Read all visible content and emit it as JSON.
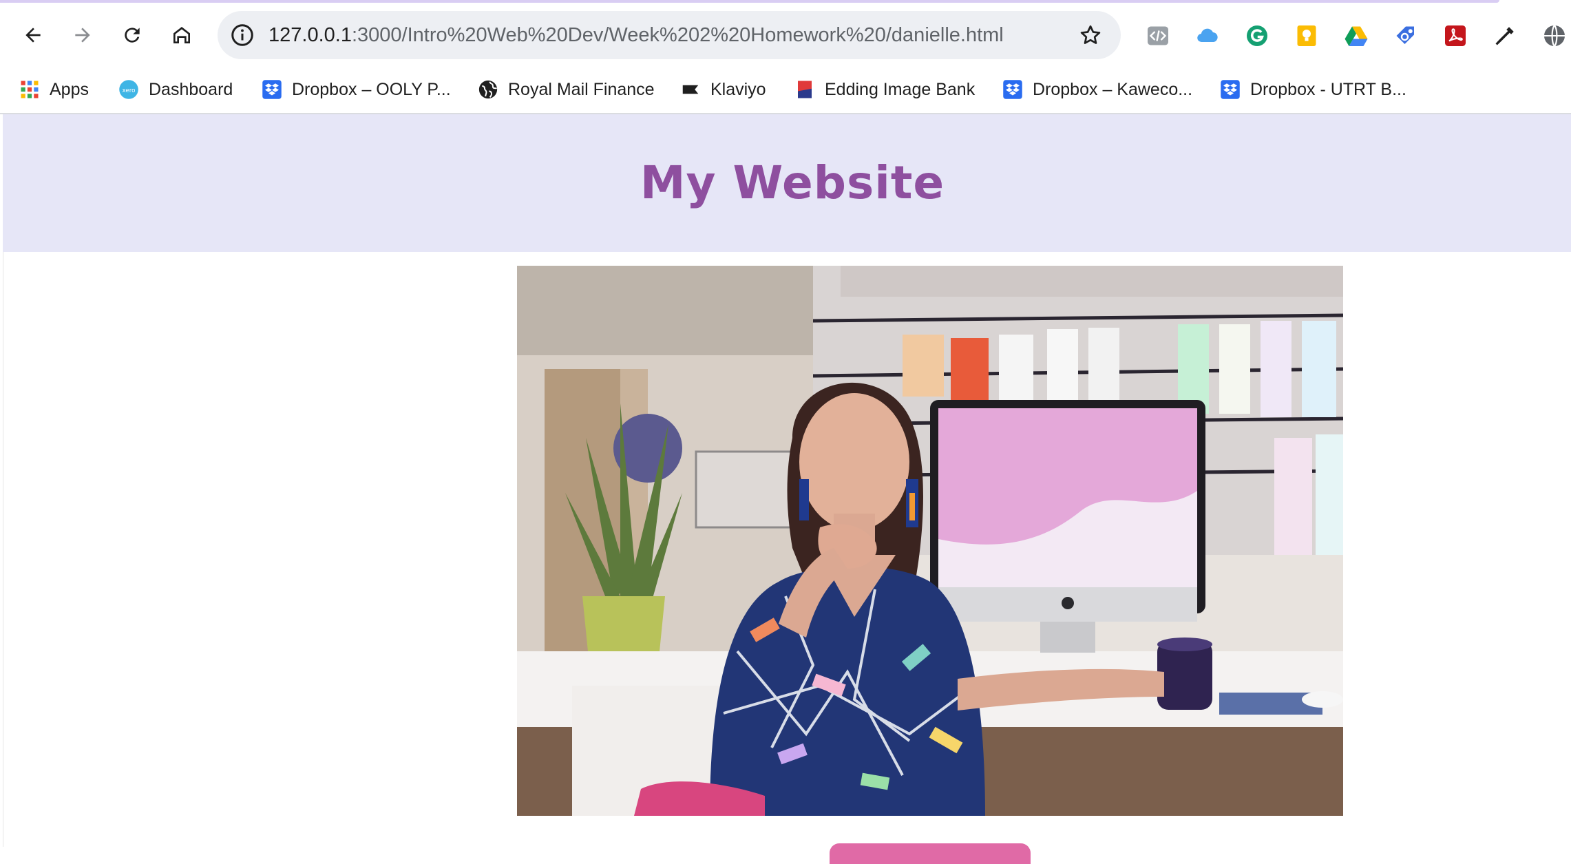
{
  "browser": {
    "url_host": "127.0.0.1",
    "url_rest": ":3000/Intro%20Web%20Dev/Week%202%20Homework%20/danielle.html",
    "nav": {
      "back_icon": "back-arrow-icon",
      "forward_icon": "forward-arrow-icon",
      "reload_icon": "reload-icon",
      "home_icon": "home-icon"
    },
    "extensions": [
      "devtools-code-icon",
      "cloud-icon",
      "grammarly-icon",
      "keep-note-icon",
      "google-drive-icon",
      "tag-extension-icon",
      "pdf-icon",
      "eyedropper-icon",
      "globe-extension-icon"
    ]
  },
  "bookmarks": [
    {
      "label": "Apps",
      "icon": "apps-grid-icon"
    },
    {
      "label": "Dashboard",
      "icon": "xero-icon"
    },
    {
      "label": "Dropbox – OOLY P...",
      "icon": "dropbox-icon"
    },
    {
      "label": "Royal Mail Finance",
      "icon": "globe-icon"
    },
    {
      "label": "Klaviyo",
      "icon": "klaviyo-flag-icon"
    },
    {
      "label": "Edding Image Bank",
      "icon": "edding-icon"
    },
    {
      "label": "Dropbox – Kaweco...",
      "icon": "dropbox-icon"
    },
    {
      "label": "Dropbox - UTRT B...",
      "icon": "dropbox-icon"
    }
  ],
  "page": {
    "title": "My Website",
    "header_bg": "#e6e6f7",
    "title_color": "#8e4f9f",
    "button_color": "#e06aa6"
  }
}
